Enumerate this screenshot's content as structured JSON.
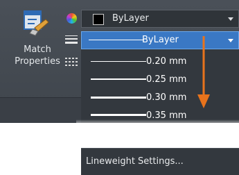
{
  "ribbon": {
    "match_properties": {
      "line1": "Match",
      "line2": "Properties",
      "icon": "match-properties-icon"
    },
    "icons": [
      "color-wheel-icon",
      "lineweight-icon",
      "linetype-icon"
    ]
  },
  "color_combo": {
    "label": "ByLayer",
    "swatch_color": "#000000"
  },
  "lineweight_combo": {
    "selected": "ByLayer",
    "options": [
      {
        "label": "0.20 mm"
      },
      {
        "label": "0.25 mm"
      },
      {
        "label": "0.30 mm"
      },
      {
        "label": "0.35 mm"
      }
    ]
  },
  "settings_item": {
    "label": "Lineweight Settings..."
  },
  "colors": {
    "ribbon_bg": "#4a5058",
    "dropdown_bg": "#33383e",
    "highlight": "#3a78c4",
    "annotation_arrow": "#e8731c"
  }
}
